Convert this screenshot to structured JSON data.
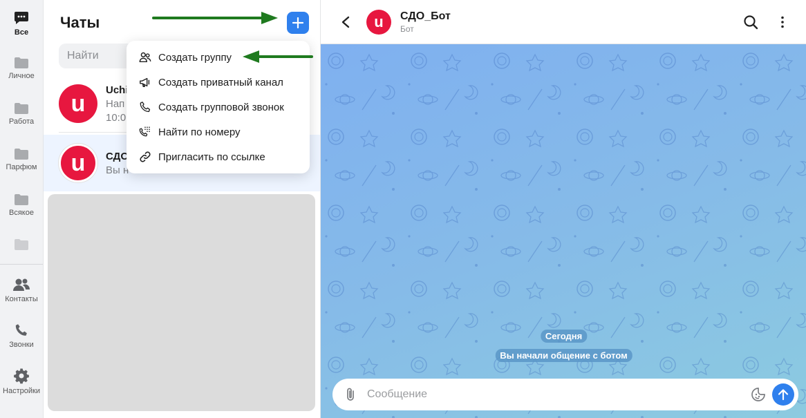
{
  "colors": {
    "accent": "#2f80ed",
    "brand": "#e7173f",
    "arrow": "#1f7a1f",
    "wallpaper": "#86bbe8"
  },
  "rail": {
    "items": [
      {
        "label": "Все",
        "icon": "chat-bubble-icon"
      },
      {
        "label": "Личное",
        "icon": "folder-icon"
      },
      {
        "label": "Работа",
        "icon": "folder-icon"
      },
      {
        "label": "Парфюм",
        "icon": "folder-icon"
      },
      {
        "label": "Всякое",
        "icon": "folder-icon"
      },
      {
        "label": "",
        "icon": "folder-icon"
      }
    ],
    "bottom": [
      {
        "label": "Контакты",
        "icon": "contacts-icon"
      },
      {
        "label": "Звонки",
        "icon": "phone-icon"
      },
      {
        "label": "Настройки",
        "icon": "gear-icon"
      }
    ]
  },
  "chatlist": {
    "title": "Чаты",
    "search_placeholder": "Найти",
    "chats": [
      {
        "avatar_letter": "u",
        "name": "Uchi",
        "preview": "Нап",
        "time": "10:0"
      },
      {
        "avatar_letter": "u",
        "name": "СДО",
        "preview": "Вы н"
      }
    ]
  },
  "menu": {
    "items": [
      {
        "label": "Создать группу",
        "icon": "group-icon"
      },
      {
        "label": "Создать приватный канал",
        "icon": "megaphone-icon"
      },
      {
        "label": "Создать групповой звонок",
        "icon": "phone-icon"
      },
      {
        "label": "Найти по номеру",
        "icon": "dialpad-icon"
      },
      {
        "label": "Пригласить по ссылке",
        "icon": "link-icon"
      }
    ]
  },
  "conversation": {
    "avatar_letter": "u",
    "name": "СДО_Бот",
    "status": "Бот",
    "date_pill": "Сегодня",
    "system_message": "Вы начали общение с ботом",
    "composer_placeholder": "Сообщение"
  }
}
